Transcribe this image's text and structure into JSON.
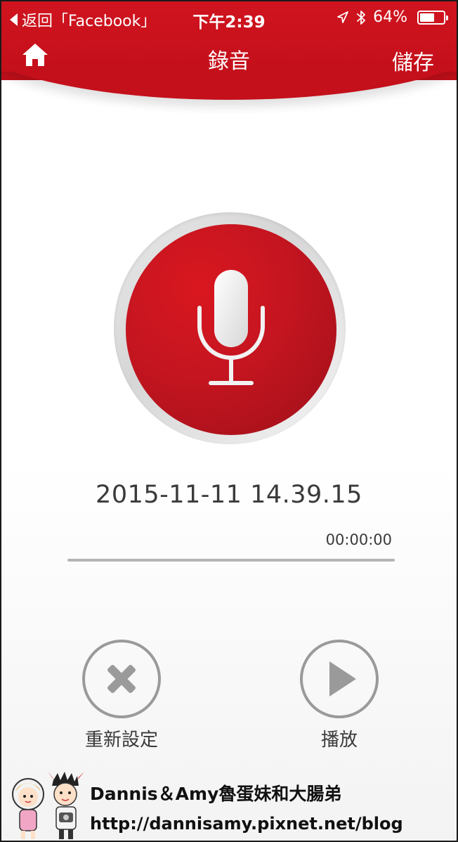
{
  "status_bar": {
    "back_app": "返回「Facebook」",
    "time": "下午2:39",
    "battery": "64%",
    "battery_level": 0.64,
    "icons": [
      "location-arrow-icon",
      "bluetooth-icon",
      "battery-icon"
    ]
  },
  "nav": {
    "home_icon": "home-icon",
    "title": "錄音",
    "save_label": "儲存"
  },
  "recorder": {
    "mic_icon": "microphone-icon",
    "timestamp": "2015-11-11 14.39.15",
    "duration": "00:00:00",
    "progress": 0
  },
  "actions": {
    "reset_label": "重新設定",
    "reset_icon": "close-x-icon",
    "play_label": "播放",
    "play_icon": "play-icon"
  },
  "watermark": {
    "title": "Dannis＆Amy魯蛋妹和大腸弟",
    "url": "http://dannisamy.pixnet.net/blog"
  },
  "colors": {
    "accent": "#c41520",
    "neutral_icon": "#9a9a9a",
    "text": "#3a3a3a"
  }
}
